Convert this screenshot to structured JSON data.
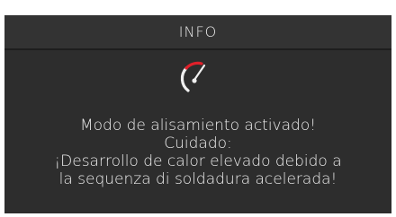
{
  "dialog": {
    "title": "INFO",
    "icon": "speedometer-icon",
    "accent_color": "#e0202a",
    "message_lines": [
      "Modo de alisamiento activado!",
      "Cuidado:",
      "¡Desarrollo de calor elevado debido a",
      "la sequenza di soldadura acelerada!"
    ]
  }
}
